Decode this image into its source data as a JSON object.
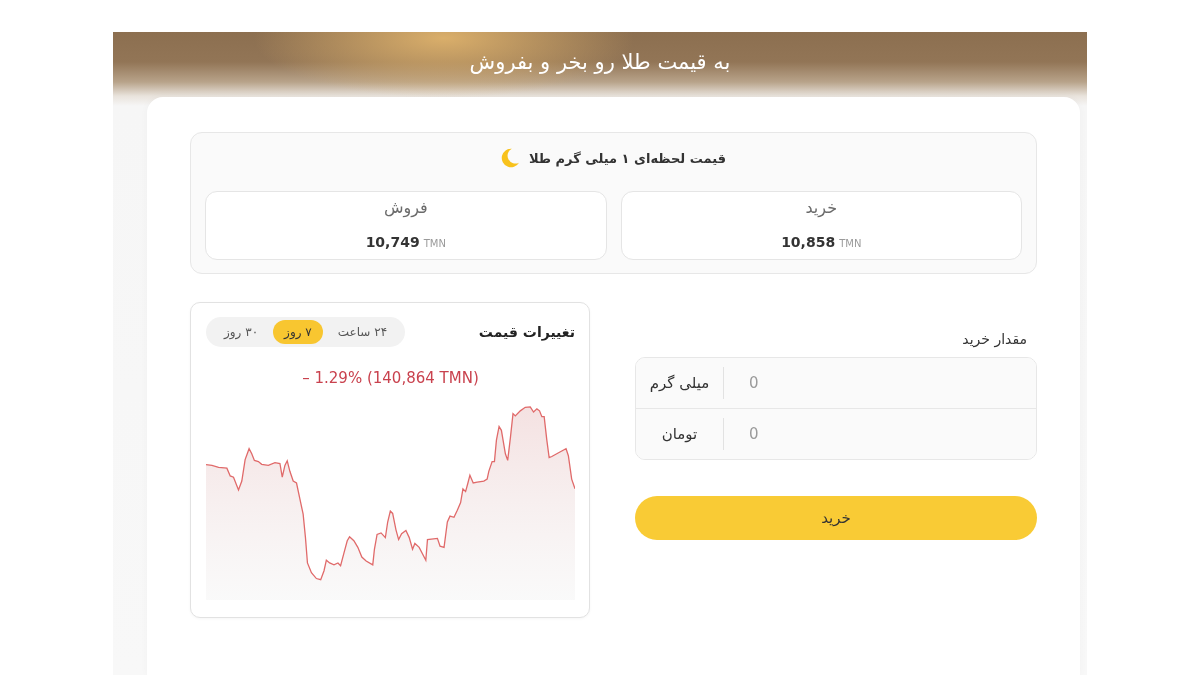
{
  "header": {
    "title": "به قیمت طلا رو بخر و بفروش"
  },
  "price_panel": {
    "title": "قیمت لحظه‌ای ۱ میلی گرم طلا",
    "cards": [
      {
        "label": "خرید",
        "value": "10,858",
        "unit": "TMN"
      },
      {
        "label": "فروش",
        "value": "10,749",
        "unit": "TMN"
      }
    ]
  },
  "purchase_form": {
    "label": "مقدار خرید",
    "fields": [
      {
        "unit": "میلی گرم",
        "placeholder": "0"
      },
      {
        "unit": "تومان",
        "placeholder": "0"
      }
    ],
    "button": "خرید"
  },
  "price_chart": {
    "title": "تغییرات قیمت",
    "periods": [
      {
        "label": "۲۴ ساعت",
        "selected": false
      },
      {
        "label": "۷ روز",
        "selected": true
      },
      {
        "label": "۳۰ روز",
        "selected": false
      }
    ],
    "change": "– 1.29% (140,864 TMN)"
  }
}
